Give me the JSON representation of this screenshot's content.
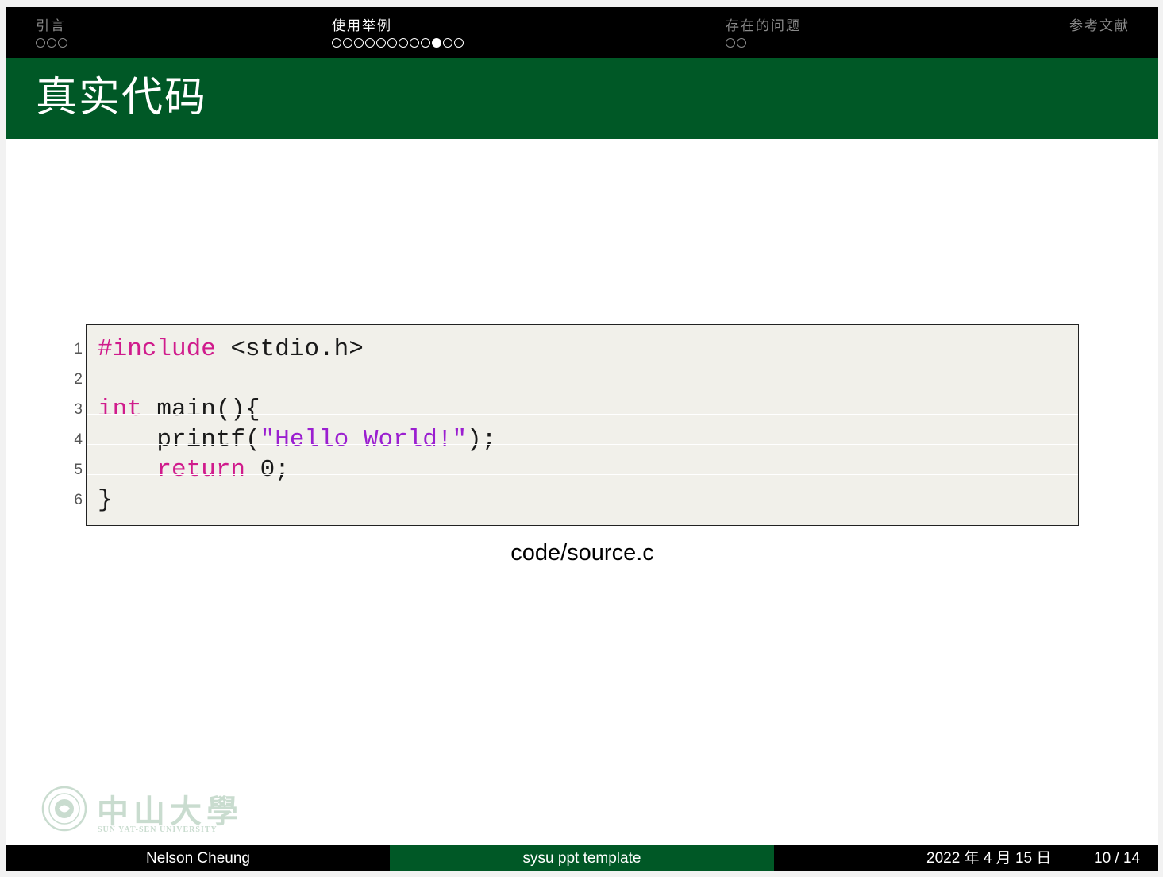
{
  "nav": {
    "sections": [
      {
        "title": "引言",
        "dots": 3,
        "current": -1,
        "active": false
      },
      {
        "title": "使用举例",
        "dots": 12,
        "current": 9,
        "active": true
      },
      {
        "title": "存在的问题",
        "dots": 2,
        "current": -1,
        "active": false
      },
      {
        "title": "参考文献",
        "dots": 0,
        "current": -1,
        "active": false
      }
    ]
  },
  "frame": {
    "title": "真实代码"
  },
  "code": {
    "lines": [
      {
        "number": "1",
        "tokens": [
          {
            "text": "#include",
            "kind": "kw"
          },
          {
            "text": " <stdio.h>",
            "kind": "plain"
          }
        ]
      },
      {
        "number": "2",
        "tokens": []
      },
      {
        "number": "3",
        "tokens": [
          {
            "text": "int",
            "kind": "kw"
          },
          {
            "text": " main(){",
            "kind": "plain"
          }
        ]
      },
      {
        "number": "4",
        "tokens": [
          {
            "text": "    printf(",
            "kind": "plain"
          },
          {
            "text": "\"Hello World!\"",
            "kind": "str"
          },
          {
            "text": ");",
            "kind": "plain"
          }
        ]
      },
      {
        "number": "5",
        "tokens": [
          {
            "text": "    ",
            "kind": "plain"
          },
          {
            "text": "return",
            "kind": "kw"
          },
          {
            "text": " 0;",
            "kind": "plain"
          }
        ]
      },
      {
        "number": "6",
        "tokens": [
          {
            "text": "}",
            "kind": "plain"
          }
        ]
      }
    ],
    "caption": "code/source.c"
  },
  "logo": {
    "name": "中山大學",
    "subtitle": "SUN YAT-SEN UNIVERSITY"
  },
  "footer": {
    "author": "Nelson Cheung",
    "title": "sysu ppt template",
    "date": "2022 年 4 月 15 日",
    "page": "10 / 14"
  },
  "colors": {
    "nav_bg": "#000000",
    "title_bg": "#005826",
    "keyword": "#d01b8c",
    "string": "#9b1fd0",
    "code_bg": "#f1f0ea"
  }
}
